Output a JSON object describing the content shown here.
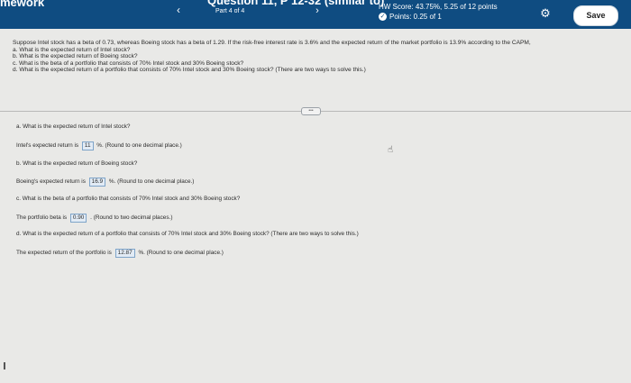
{
  "header": {
    "app_title": "mework",
    "question_title": "Question 11, P 12-32 (similar to)",
    "part": "Part 4 of 4",
    "hw_score": "HW Score: 43.75%, 5.25 of 12 points",
    "points": "Points: 0.25 of 1",
    "save_label": "Save",
    "prev_icon": "chevron-left-icon",
    "next_icon": "chevron-right-icon",
    "settings_icon": "gear-icon"
  },
  "question": {
    "intro": "Suppose Intel stock has a beta of 0.73, whereas Boeing stock has a beta of 1.29. If the risk-free interest rate is 3.6% and the expected return of the market portfolio is 13.9% according to the CAPM,",
    "a": "a. What is the expected return of Intel stock?",
    "b": "b. What is the expected return of Boeing stock?",
    "c": "c. What is the beta of a portfolio that consists of 70% Intel stock and 30% Boeing stock?",
    "d": "d. What is the expected return of a portfolio that consists of 70% Intel stock and 30% Boeing stock? (There are two ways to solve this.)"
  },
  "answers": {
    "a_question": "a. What is the expected return of Intel stock?",
    "a_prefix": "Intel's expected return is",
    "a_value": "11",
    "a_suffix": "%. (Round to one decimal place.)",
    "b_question": "b. What is the expected return of Boeing stock?",
    "b_prefix": "Boeing's expected return is",
    "b_value": "16.9",
    "b_suffix": "%. (Round to one decimal place.)",
    "c_question": "c. What is the beta of a portfolio that consists of 70% Intel stock and 30% Boeing stock?",
    "c_prefix": "The portfolio beta is",
    "c_value": "0.90",
    "c_suffix": ". (Round to two decimal places.)",
    "d_question": "d. What is the expected return of a portfolio that consists of 70% Intel stock and 30% Boeing stock? (There are two ways to solve this.)",
    "d_prefix": "The expected return of the portfolio is",
    "d_value": "12.87",
    "d_suffix": "%. (Round to one decimal place.)"
  },
  "colors": {
    "header_bg": "#0f4c81",
    "answer_box_border": "#7ea4c9",
    "answer_box_bg": "#e2ebf5"
  }
}
